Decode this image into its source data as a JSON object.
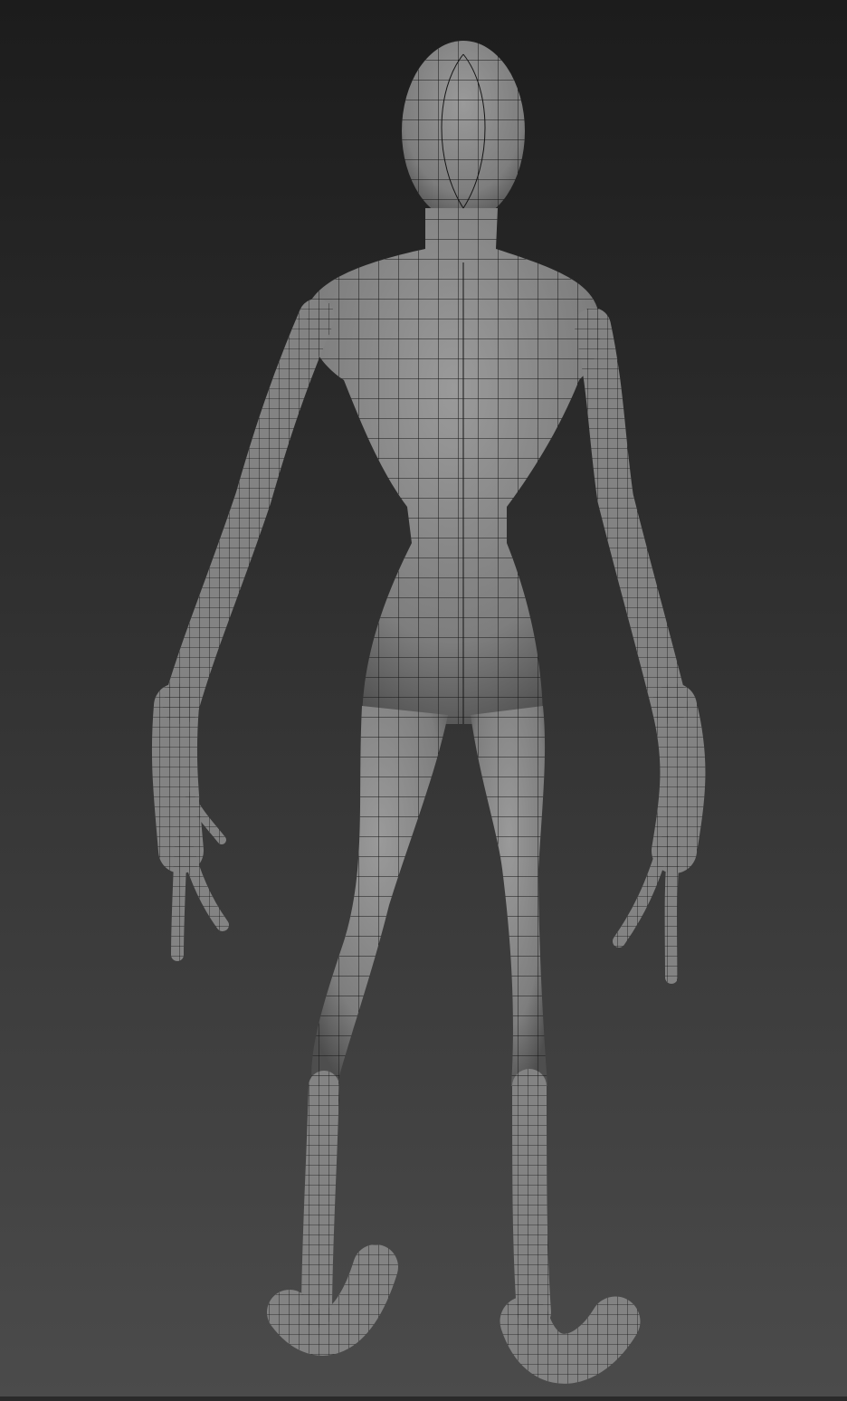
{
  "scene": {
    "subject": "wireframe-creature-back-view",
    "colors": {
      "background_top": "#1c1c1c",
      "background_bottom": "#4b4b4b",
      "mesh_fill": "#8c8c8c",
      "mesh_shadow": "#4a4a4a",
      "wire": "#111111"
    }
  }
}
